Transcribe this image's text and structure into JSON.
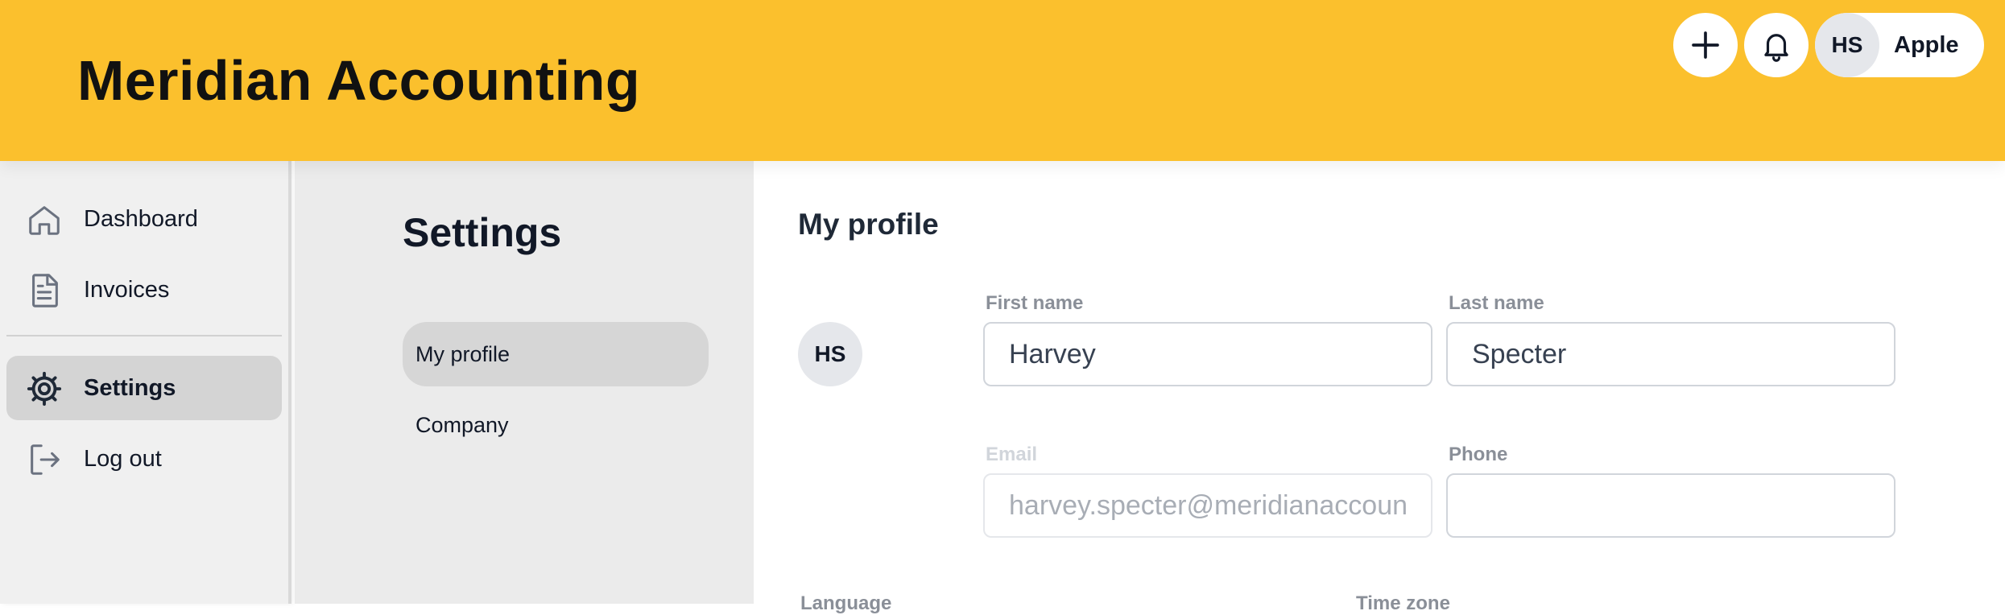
{
  "header": {
    "app_title": "Meridian Accounting",
    "user": {
      "initials": "HS",
      "name": "Apple"
    }
  },
  "sidebar": {
    "items": [
      {
        "label": "Dashboard",
        "icon": "home-icon",
        "active": false
      },
      {
        "label": "Invoices",
        "icon": "document-icon",
        "active": false
      },
      {
        "label": "Settings",
        "icon": "gear-icon",
        "active": true
      },
      {
        "label": "Log out",
        "icon": "logout-icon",
        "active": false
      }
    ]
  },
  "settings_menu": {
    "title": "Settings",
    "items": [
      {
        "label": "My profile",
        "active": true
      },
      {
        "label": "Company",
        "active": false
      }
    ]
  },
  "profile": {
    "section_title": "My profile",
    "avatar_initials": "HS",
    "first_name": {
      "label": "First name",
      "value": "Harvey"
    },
    "last_name": {
      "label": "Last name",
      "value": "Specter"
    },
    "email": {
      "label": "Email",
      "value": "harvey.specter@meridianaccounting.com",
      "disabled": true
    },
    "phone": {
      "label": "Phone",
      "value": ""
    },
    "language": {
      "label": "Language"
    },
    "time_zone": {
      "label": "Time zone"
    }
  },
  "colors": {
    "header_bg": "#fbc02d",
    "sidebar_bg": "#f0f0f0",
    "settings_bg": "#ebebeb",
    "active_item_bg": "#d4d4d4",
    "icon_stroke": "#6b7280"
  }
}
